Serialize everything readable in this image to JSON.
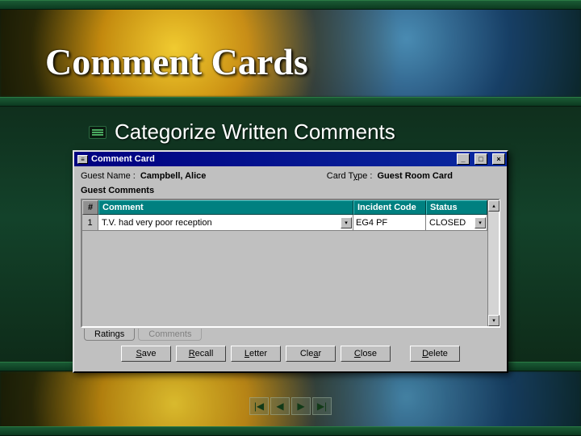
{
  "slide": {
    "title": "Comment Cards",
    "subtitle": "Categorize Written Comments"
  },
  "window": {
    "title": "Comment Card",
    "controls": {
      "min": "_",
      "max": "□",
      "close": "×"
    },
    "guest_name_label": "Guest Name :",
    "guest_name_value": "Campbell, Alice",
    "card_type_label": "Card Type :",
    "card_type_value": "Guest Room Card",
    "section_label": "Guest Comments",
    "columns": {
      "num": "#",
      "comment": "Comment",
      "incident": "Incident Code",
      "status": "Status"
    },
    "rows": [
      {
        "num": "1",
        "comment": "T.V. had very poor reception",
        "incident": "EG4 PF",
        "status": "CLOSED"
      }
    ],
    "tabs": {
      "ratings": "Ratings",
      "comments": "Comments"
    },
    "buttons": {
      "save": "Save",
      "recall": "Recall",
      "letter": "Letter",
      "clear": "Clear",
      "close": "Close",
      "delete": "Delete"
    }
  },
  "nav": {
    "first": "|◀",
    "prev": "◀",
    "next": "▶",
    "last": "▶|"
  }
}
